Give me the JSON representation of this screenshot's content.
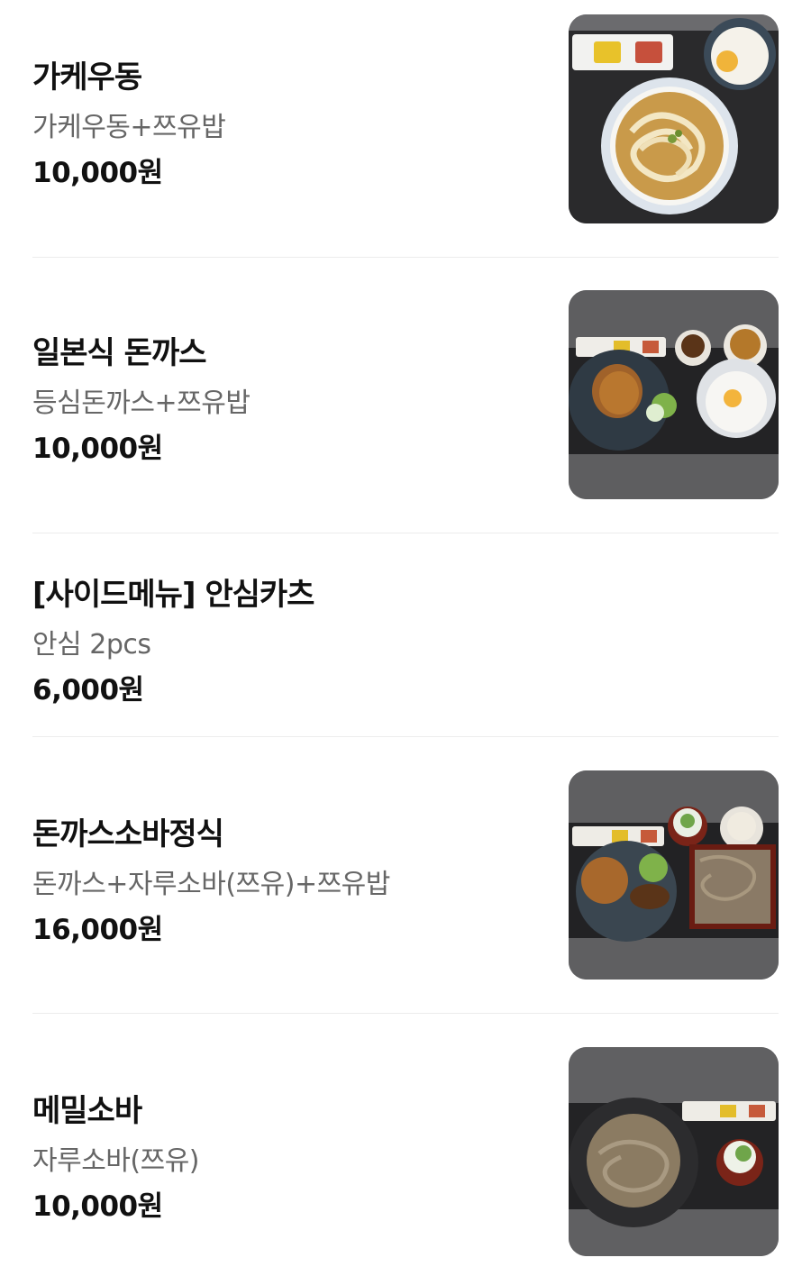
{
  "menu": {
    "items": [
      {
        "name": "가케우동",
        "description": "가케우동+쯔유밥",
        "price": "10,000원",
        "image": "kake-udon-photo"
      },
      {
        "name": "일본식 돈까스",
        "description": "등심돈까스+쯔유밥",
        "price": "10,000원",
        "image": "tonkatsu-set-photo"
      },
      {
        "name": "[사이드메뉴] 안심카츠",
        "description": "안심 2pcs",
        "price": "6,000원"
      },
      {
        "name": "돈까스소바정식",
        "description": "돈까스+자루소바(쯔유)+쯔유밥",
        "price": "16,000원",
        "image": "tonkatsu-soba-set-photo"
      },
      {
        "name": "메밀소바",
        "description": "자루소바(쯔유)",
        "price": "10,000원",
        "image": "zaru-soba-photo"
      }
    ]
  },
  "colors": {
    "text_primary": "#111111",
    "text_secondary": "#666666",
    "divider": "#ececec"
  }
}
